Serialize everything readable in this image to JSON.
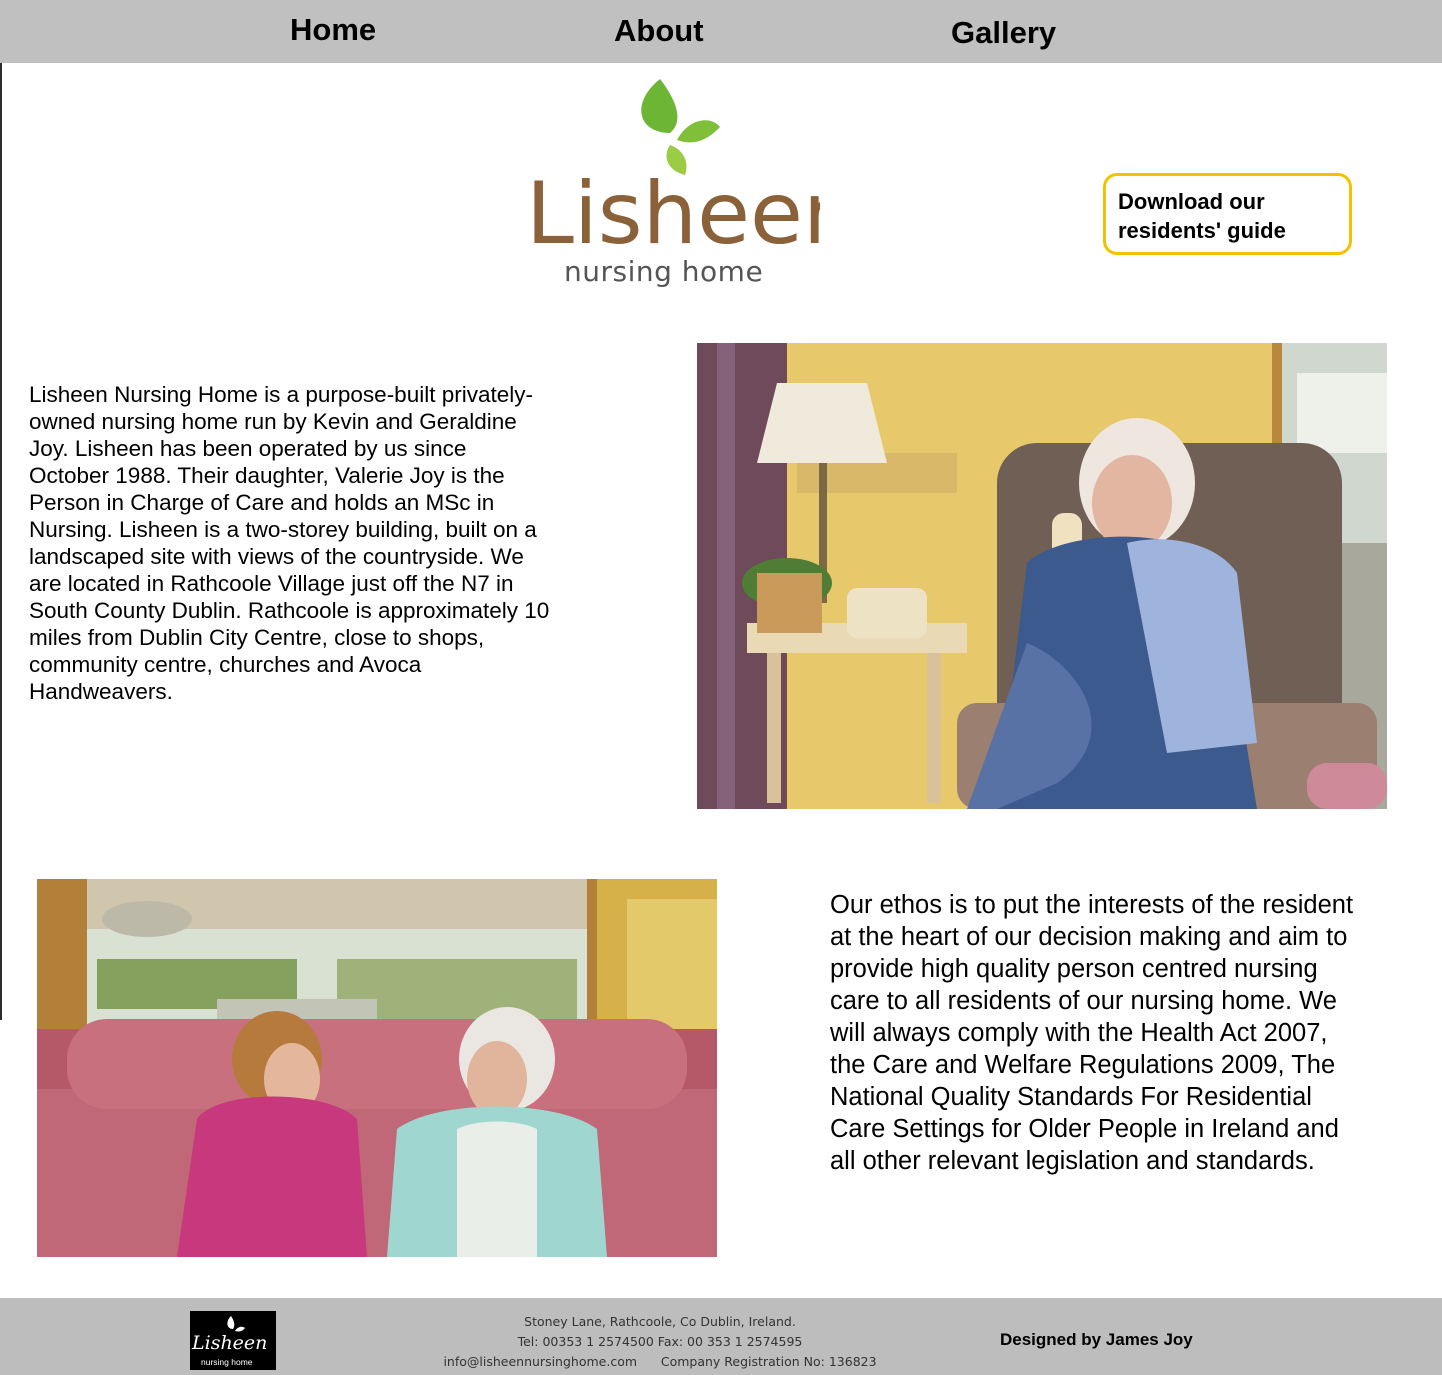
{
  "nav": {
    "items": [
      {
        "label": "Home"
      },
      {
        "label": "About"
      },
      {
        "label": "Gallery"
      }
    ]
  },
  "logo": {
    "wordmark": "Lisheen",
    "subtitle": "nursing home",
    "colors": {
      "leaf_dark": "#5fae2e",
      "leaf_light": "#93c83e",
      "text": "#8a6139"
    }
  },
  "download_button": {
    "label": "Download our residents' guide",
    "border_color": "#f2c200"
  },
  "intro": {
    "text": "Lisheen Nursing Home is a purpose-built privately-\nowned nursing home run by Kevin and Geraldine\nJoy.  Lisheen has been operated by us since\nOctober 1988.  Their daughter, Valerie Joy is the\nPerson in Charge of Care and holds an MSc in\nNursing.  Lisheen is a two-storey building, built on a\nlandscaped site with views of the countryside. We\nare located in Rathcoole Village just off the N7 in\nSouth County Dublin.  Rathcoole is approximately 10\nmiles from Dublin City Centre, close to shops,\ncommunity centre, churches and Avoca\nHandweavers."
  },
  "ethos": {
    "text": "Our ethos is to put the interests of the resident\nat the heart of our decision making and aim to\nprovide high quality person centred nursing\ncare to all residents of our nursing home.  We\nwill always comply with the Health Act 2007,\nthe Care and Welfare Regulations 2009, The\nNational Quality Standards For Residential\nCare Settings for Older People in Ireland and\nall other relevant legislation and standards."
  },
  "footer": {
    "logo_word": "Lisheen",
    "logo_sub": "nursing home",
    "address_line1": "Stoney Lane, Rathcoole, Co Dublin, Ireland.",
    "address_line2": "Tel: 00353 1 2574500 Fax: 00 353 1 2574595",
    "address_line3": "info@lisheennursinghome.com      Company Registration No: 136823",
    "designer": "Designed by James Joy"
  },
  "colors": {
    "nav_bg": "#c0c0c0",
    "footer_bg": "#bdbdbd"
  }
}
